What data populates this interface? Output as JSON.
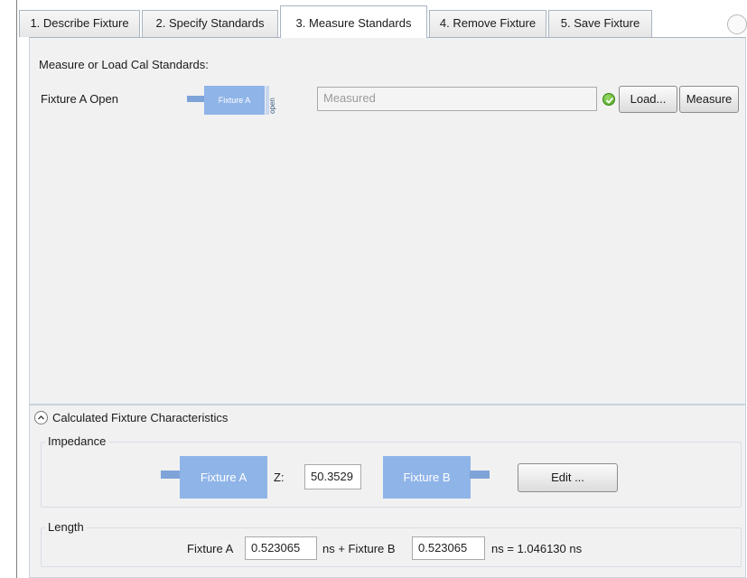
{
  "tabs": [
    {
      "label": "1. Describe Fixture"
    },
    {
      "label": "2. Specify Standards"
    },
    {
      "label": "3. Measure Standards"
    },
    {
      "label": "4. Remove Fixture"
    },
    {
      "label": "5. Save Fixture"
    }
  ],
  "measure": {
    "heading": "Measure or Load Cal Standards:",
    "row_label": "Fixture A Open",
    "graphic_box": "Fixture A",
    "graphic_side": "open",
    "status_placeholder": "Measured",
    "load_button": "Load...",
    "measure_button": "Measure"
  },
  "calc": {
    "title": "Calculated Fixture Characteristics",
    "impedance": {
      "label": "Impedance",
      "fixture_a": "Fixture A",
      "z_label": "Z:",
      "z_value": "50.3529",
      "fixture_b": "Fixture B",
      "edit_button": "Edit ..."
    },
    "length": {
      "label": "Length",
      "fixture_a_label": "Fixture A",
      "fixture_a_value": "0.523065",
      "plus_fixture_b_label": "ns + Fixture B",
      "fixture_b_value": "0.523065",
      "total_text": "ns = 1.046130 ns"
    }
  },
  "colors": {
    "fixture_blue": "#8fb4e8",
    "status_ok": "#4aa41f",
    "panel_bg": "#f1f1f1"
  }
}
